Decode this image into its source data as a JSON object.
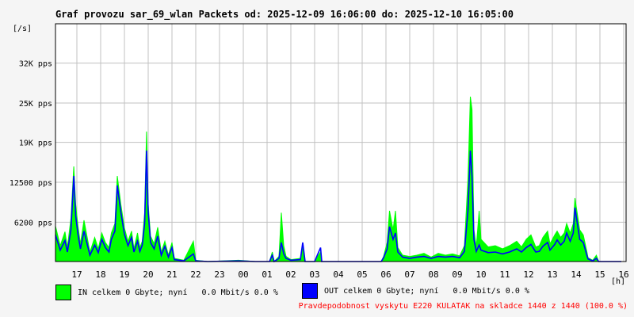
{
  "header": {
    "title": "Graf provozu sar_69_wlan Packets od: 2025-12-09 16:06:00 do: 2025-12-10 16:05:00",
    "y_unit": "[/s]",
    "x_unit": "[h]"
  },
  "legend": {
    "in": {
      "label": "IN celkem 0 Gbyte; nyní   0.0 Mbit/s 0.0 %",
      "color": "#00ff00"
    },
    "out": {
      "label": "OUT celkem 0 Gbyte; nyní   0.0 Mbit/s 0.0 %",
      "color": "#0000ff"
    }
  },
  "footer_note": {
    "text": "Pravdepodobnost vyskytu E220 KULATAK na skladce 1440 z 1440 (100.0 %)",
    "color": "#ff0000"
  },
  "chart_data": {
    "type": "area",
    "ylim": [
      0,
      37500
    ],
    "xlim": [
      16.1,
      16.1
    ],
    "grid": true,
    "y_ticks": [
      {
        "value": 6200,
        "label": "6200 pps"
      },
      {
        "value": 12500,
        "label": "12500 pps"
      },
      {
        "value": 18800,
        "label": "19K pps"
      },
      {
        "value": 25000,
        "label": "25K pps"
      },
      {
        "value": 31300,
        "label": "32K pps"
      }
    ],
    "x_ticks": [
      "17",
      "18",
      "19",
      "20",
      "21",
      "22",
      "23",
      "00",
      "01",
      "02",
      "03",
      "04",
      "05",
      "06",
      "07",
      "08",
      "09",
      "10",
      "11",
      "12",
      "13",
      "14",
      "15",
      "16"
    ],
    "x_start_hour": 16.1,
    "series": [
      {
        "name": "IN",
        "color": "#00ff00",
        "points": [
          [
            16.1,
            5600
          ],
          [
            16.3,
            2500
          ],
          [
            16.5,
            4700
          ],
          [
            16.6,
            2200
          ],
          [
            16.75,
            6800
          ],
          [
            16.87,
            15000
          ],
          [
            16.95,
            9000
          ],
          [
            17.05,
            5500
          ],
          [
            17.15,
            2800
          ],
          [
            17.3,
            6500
          ],
          [
            17.45,
            3500
          ],
          [
            17.55,
            1500
          ],
          [
            17.75,
            3800
          ],
          [
            17.9,
            2000
          ],
          [
            18.05,
            4500
          ],
          [
            18.2,
            3000
          ],
          [
            18.35,
            2200
          ],
          [
            18.45,
            4500
          ],
          [
            18.6,
            6000
          ],
          [
            18.7,
            13500
          ],
          [
            18.85,
            9000
          ],
          [
            19.0,
            5300
          ],
          [
            19.15,
            3200
          ],
          [
            19.3,
            4800
          ],
          [
            19.4,
            2000
          ],
          [
            19.55,
            4500
          ],
          [
            19.65,
            2200
          ],
          [
            19.75,
            3200
          ],
          [
            19.85,
            7700
          ],
          [
            19.93,
            20500
          ],
          [
            20.0,
            9000
          ],
          [
            20.1,
            4000
          ],
          [
            20.25,
            2800
          ],
          [
            20.4,
            5400
          ],
          [
            20.55,
            1500
          ],
          [
            20.7,
            3200
          ],
          [
            20.85,
            1000
          ],
          [
            21.0,
            3000
          ],
          [
            21.1,
            500
          ],
          [
            21.5,
            200
          ],
          [
            21.9,
            3200
          ],
          [
            22.0,
            200
          ],
          [
            22.5,
            0
          ],
          [
            23.8,
            200
          ],
          [
            24.5,
            0
          ],
          [
            25.1,
            0
          ],
          [
            25.22,
            1500
          ],
          [
            25.3,
            0
          ],
          [
            25.5,
            800
          ],
          [
            25.6,
            7700
          ],
          [
            25.7,
            2500
          ],
          [
            25.8,
            800
          ],
          [
            26.0,
            300
          ],
          [
            26.4,
            500
          ],
          [
            26.5,
            2500
          ],
          [
            26.6,
            0
          ],
          [
            27.0,
            0
          ],
          [
            27.25,
            1500
          ],
          [
            27.3,
            0
          ],
          [
            28.0,
            0
          ],
          [
            29.8,
            0
          ],
          [
            29.9,
            800
          ],
          [
            30.05,
            3000
          ],
          [
            30.15,
            8000
          ],
          [
            30.3,
            5000
          ],
          [
            30.4,
            8000
          ],
          [
            30.5,
            2200
          ],
          [
            30.7,
            1000
          ],
          [
            31.0,
            800
          ],
          [
            31.3,
            1000
          ],
          [
            31.6,
            1300
          ],
          [
            31.9,
            700
          ],
          [
            32.2,
            1300
          ],
          [
            32.5,
            1000
          ],
          [
            32.8,
            1200
          ],
          [
            33.1,
            900
          ],
          [
            33.3,
            2500
          ],
          [
            33.45,
            13000
          ],
          [
            33.55,
            26000
          ],
          [
            33.62,
            24000
          ],
          [
            33.7,
            5000
          ],
          [
            33.8,
            2300
          ],
          [
            33.92,
            8000
          ],
          [
            34.0,
            3500
          ],
          [
            34.3,
            2300
          ],
          [
            34.6,
            2500
          ],
          [
            34.9,
            2000
          ],
          [
            35.2,
            2500
          ],
          [
            35.5,
            3200
          ],
          [
            35.7,
            2300
          ],
          [
            35.9,
            3500
          ],
          [
            36.1,
            4200
          ],
          [
            36.3,
            2300
          ],
          [
            36.45,
            2500
          ],
          [
            36.6,
            3800
          ],
          [
            36.8,
            4800
          ],
          [
            36.9,
            2800
          ],
          [
            37.1,
            4200
          ],
          [
            37.2,
            4800
          ],
          [
            37.35,
            3800
          ],
          [
            37.5,
            4500
          ],
          [
            37.6,
            6000
          ],
          [
            37.75,
            4500
          ],
          [
            37.88,
            6000
          ],
          [
            37.95,
            10000
          ],
          [
            38.05,
            7500
          ],
          [
            38.15,
            5000
          ],
          [
            38.3,
            4200
          ],
          [
            38.45,
            1600
          ],
          [
            38.5,
            600
          ],
          [
            38.7,
            200
          ],
          [
            38.85,
            1000
          ],
          [
            38.95,
            0
          ],
          [
            39.9,
            0
          ]
        ]
      },
      {
        "name": "OUT",
        "color": "#0000ff",
        "points": [
          [
            16.1,
            4200
          ],
          [
            16.3,
            1800
          ],
          [
            16.5,
            3300
          ],
          [
            16.6,
            1500
          ],
          [
            16.75,
            5000
          ],
          [
            16.87,
            13500
          ],
          [
            16.95,
            7200
          ],
          [
            17.05,
            4200
          ],
          [
            17.15,
            2000
          ],
          [
            17.3,
            4800
          ],
          [
            17.45,
            2500
          ],
          [
            17.55,
            1000
          ],
          [
            17.75,
            2600
          ],
          [
            17.9,
            1400
          ],
          [
            18.05,
            3500
          ],
          [
            18.2,
            2200
          ],
          [
            18.35,
            1500
          ],
          [
            18.45,
            3500
          ],
          [
            18.6,
            4800
          ],
          [
            18.7,
            12000
          ],
          [
            18.85,
            7800
          ],
          [
            19.0,
            4300
          ],
          [
            19.15,
            2500
          ],
          [
            19.3,
            3800
          ],
          [
            19.4,
            1500
          ],
          [
            19.55,
            3200
          ],
          [
            19.65,
            1600
          ],
          [
            19.75,
            2600
          ],
          [
            19.85,
            6000
          ],
          [
            19.93,
            17500
          ],
          [
            20.0,
            7800
          ],
          [
            20.1,
            3000
          ],
          [
            20.25,
            2000
          ],
          [
            20.4,
            4000
          ],
          [
            20.55,
            1000
          ],
          [
            20.7,
            2400
          ],
          [
            20.85,
            700
          ],
          [
            21.0,
            2200
          ],
          [
            21.1,
            300
          ],
          [
            21.5,
            100
          ],
          [
            21.9,
            1200
          ],
          [
            22.0,
            100
          ],
          [
            22.5,
            0
          ],
          [
            23.8,
            100
          ],
          [
            24.5,
            0
          ],
          [
            25.1,
            0
          ],
          [
            25.22,
            1000
          ],
          [
            25.3,
            0
          ],
          [
            25.5,
            500
          ],
          [
            25.6,
            3000
          ],
          [
            25.7,
            1200
          ],
          [
            25.8,
            500
          ],
          [
            26.0,
            200
          ],
          [
            26.4,
            300
          ],
          [
            26.5,
            3000
          ],
          [
            26.6,
            0
          ],
          [
            27.0,
            0
          ],
          [
            27.25,
            2200
          ],
          [
            27.3,
            0
          ],
          [
            28.0,
            0
          ],
          [
            29.8,
            0
          ],
          [
            29.9,
            600
          ],
          [
            30.05,
            2000
          ],
          [
            30.15,
            5500
          ],
          [
            30.3,
            3500
          ],
          [
            30.4,
            4500
          ],
          [
            30.5,
            1500
          ],
          [
            30.7,
            700
          ],
          [
            31.0,
            500
          ],
          [
            31.3,
            700
          ],
          [
            31.6,
            800
          ],
          [
            31.9,
            500
          ],
          [
            32.2,
            800
          ],
          [
            32.5,
            700
          ],
          [
            32.8,
            800
          ],
          [
            33.1,
            600
          ],
          [
            33.3,
            1600
          ],
          [
            33.45,
            8000
          ],
          [
            33.55,
            17500
          ],
          [
            33.62,
            13500
          ],
          [
            33.7,
            3500
          ],
          [
            33.8,
            1600
          ],
          [
            33.92,
            2600
          ],
          [
            34.0,
            1800
          ],
          [
            34.3,
            1400
          ],
          [
            34.6,
            1500
          ],
          [
            34.9,
            1200
          ],
          [
            35.2,
            1500
          ],
          [
            35.5,
            2000
          ],
          [
            35.7,
            1500
          ],
          [
            35.9,
            2200
          ],
          [
            36.1,
            2700
          ],
          [
            36.3,
            1500
          ],
          [
            36.45,
            1600
          ],
          [
            36.6,
            2400
          ],
          [
            36.8,
            3000
          ],
          [
            36.9,
            1800
          ],
          [
            37.1,
            2700
          ],
          [
            37.2,
            3400
          ],
          [
            37.35,
            2600
          ],
          [
            37.5,
            3200
          ],
          [
            37.6,
            4500
          ],
          [
            37.75,
            3200
          ],
          [
            37.88,
            4500
          ],
          [
            37.95,
            8500
          ],
          [
            38.05,
            6000
          ],
          [
            38.15,
            3500
          ],
          [
            38.3,
            3000
          ],
          [
            38.45,
            1000
          ],
          [
            38.5,
            400
          ],
          [
            38.7,
            100
          ],
          [
            38.85,
            500
          ],
          [
            38.95,
            0
          ],
          [
            39.9,
            0
          ]
        ]
      }
    ]
  }
}
